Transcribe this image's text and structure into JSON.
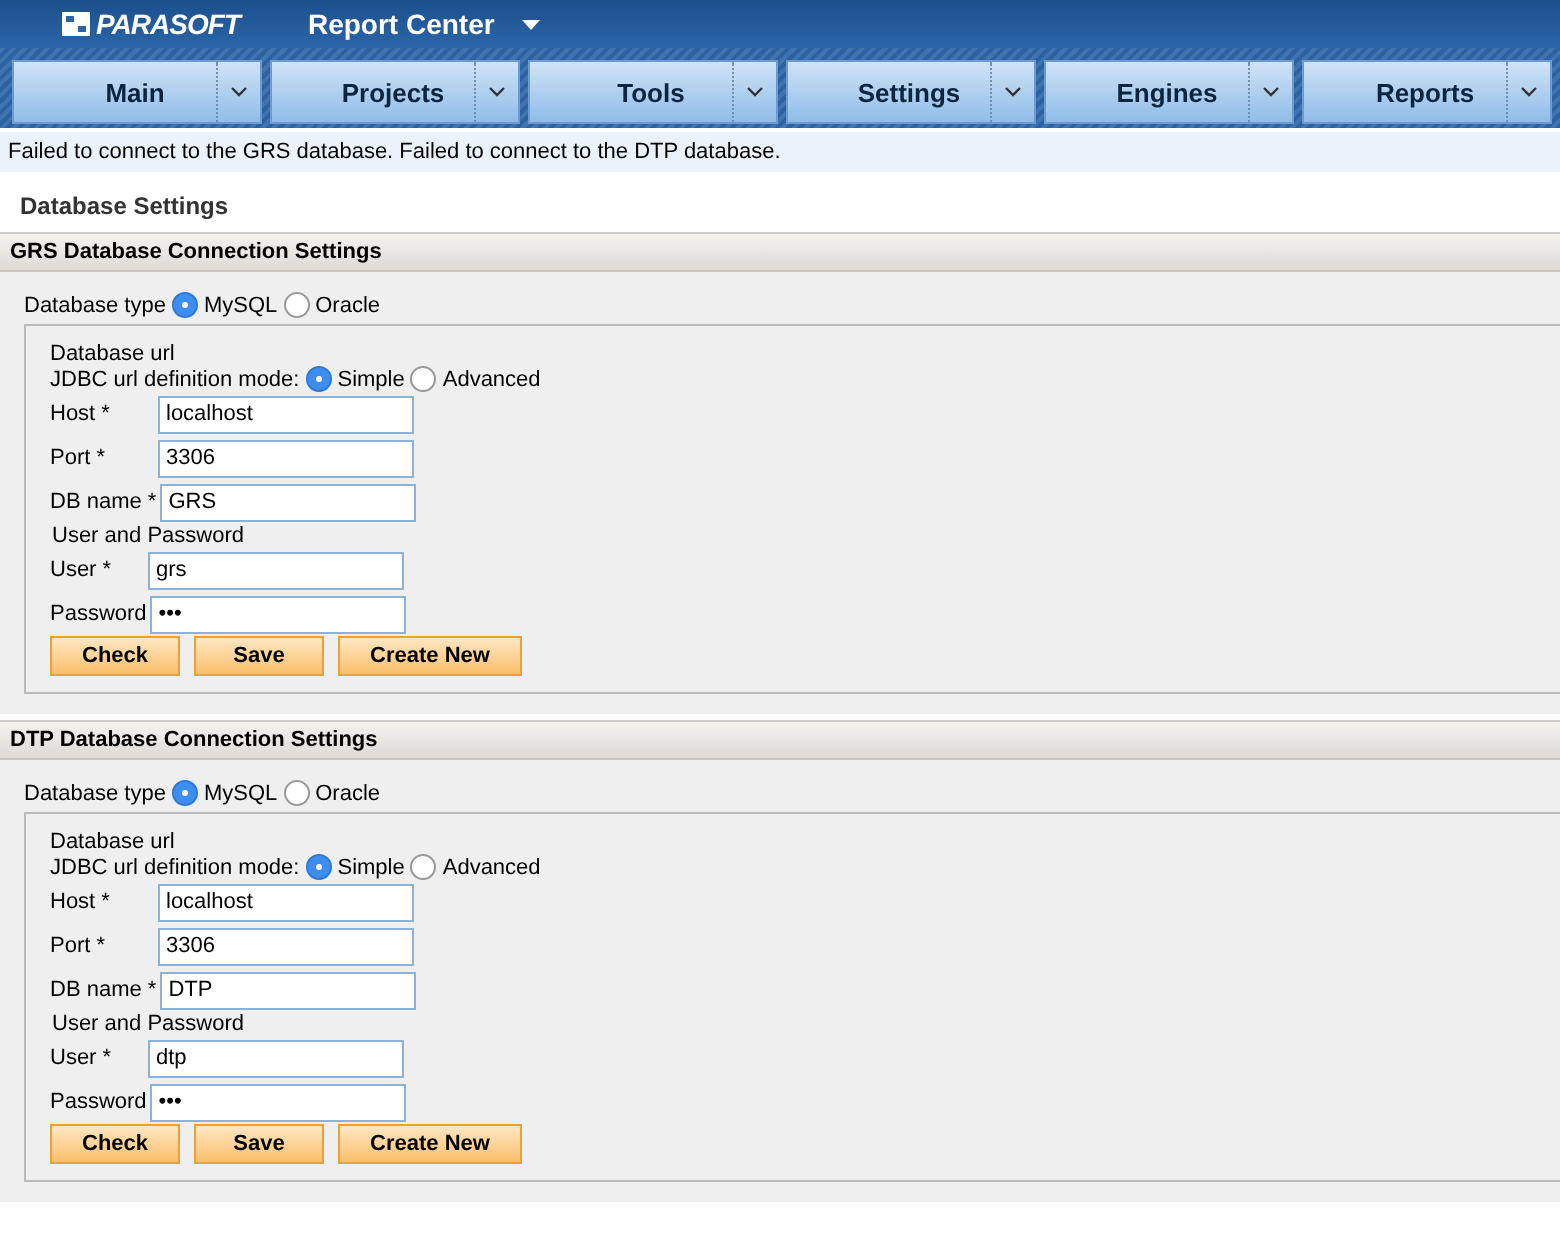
{
  "header": {
    "logo": "PARASOFT",
    "title": "Report Center"
  },
  "nav": [
    {
      "label": "Main"
    },
    {
      "label": "Projects"
    },
    {
      "label": "Tools"
    },
    {
      "label": "Settings"
    },
    {
      "label": "Engines"
    },
    {
      "label": "Reports"
    }
  ],
  "message": "Failed to connect to the GRS database. Failed to connect to the DTP database.",
  "page_title": "Database Settings",
  "sections": [
    {
      "title": "GRS Database Connection Settings",
      "type_label": "Database type",
      "types": [
        {
          "label": "MySQL",
          "selected": true
        },
        {
          "label": "Oracle",
          "selected": false
        }
      ],
      "url_heading": "Database url",
      "mode_label": "JDBC url definition mode:",
      "modes": [
        {
          "label": "Simple",
          "selected": true
        },
        {
          "label": "Advanced",
          "selected": false
        }
      ],
      "connection": [
        {
          "label": "Host *",
          "value": "localhost"
        },
        {
          "label": "Port *",
          "value": "3306"
        },
        {
          "label": "DB name *",
          "value": "GRS"
        }
      ],
      "credentials_heading": "User and Password",
      "credentials": [
        {
          "label": "User *",
          "value": "grs"
        },
        {
          "label": "Password",
          "value": "•••"
        }
      ],
      "buttons": [
        "Check",
        "Save",
        "Create New"
      ]
    },
    {
      "title": "DTP Database Connection Settings",
      "type_label": "Database type",
      "types": [
        {
          "label": "MySQL",
          "selected": true
        },
        {
          "label": "Oracle",
          "selected": false
        }
      ],
      "url_heading": "Database url",
      "mode_label": "JDBC url definition mode:",
      "modes": [
        {
          "label": "Simple",
          "selected": true
        },
        {
          "label": "Advanced",
          "selected": false
        }
      ],
      "connection": [
        {
          "label": "Host *",
          "value": "localhost"
        },
        {
          "label": "Port *",
          "value": "3306"
        },
        {
          "label": "DB name *",
          "value": "DTP"
        }
      ],
      "credentials_heading": "User and Password",
      "credentials": [
        {
          "label": "User *",
          "value": "dtp"
        },
        {
          "label": "Password",
          "value": "•••"
        }
      ],
      "buttons": [
        "Check",
        "Save",
        "Create New"
      ]
    }
  ]
}
